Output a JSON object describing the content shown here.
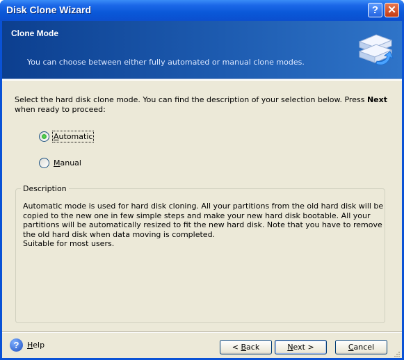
{
  "window": {
    "title": "Disk Clone Wizard",
    "help_btn": "?",
    "close_btn": "✕"
  },
  "banner": {
    "title": "Clone Mode",
    "subtitle": "You can choose between either fully automated or manual clone modes.",
    "icon": "disk-clone-icon"
  },
  "instructions": {
    "text_before": "Select the hard disk clone mode. You can find the description of your selection below. Press ",
    "bold": "Next",
    "text_after": " when ready to proceed:"
  },
  "options": [
    {
      "label_first": "A",
      "label_rest": "utomatic",
      "selected": true
    },
    {
      "label_first": "M",
      "label_rest": "anual",
      "selected": false
    }
  ],
  "description": {
    "legend": "Description",
    "line1": "Automatic mode is used for hard disk cloning. All your partitions from the old hard disk will be",
    "line2": "copied to the new one in few simple steps and make your new hard disk bootable. All your",
    "line3": "partitions will be automatically resized to fit the new hard disk. Note that you have to remove",
    "line4": "the old hard disk when data moving is completed.",
    "line5": "Suitable for most users."
  },
  "footer": {
    "help_first": "H",
    "help_rest": "elp",
    "back_pre": "< ",
    "back_first": "B",
    "back_rest": "ack",
    "next_first": "N",
    "next_rest": "ext >",
    "cancel_first": "C",
    "cancel_rest": "ancel"
  },
  "colors": {
    "title_blue": "#0a58d8",
    "banner_blue": "#1d5bb0",
    "dialog_bg": "#ece9d8",
    "radio_green": "#22a12a"
  }
}
